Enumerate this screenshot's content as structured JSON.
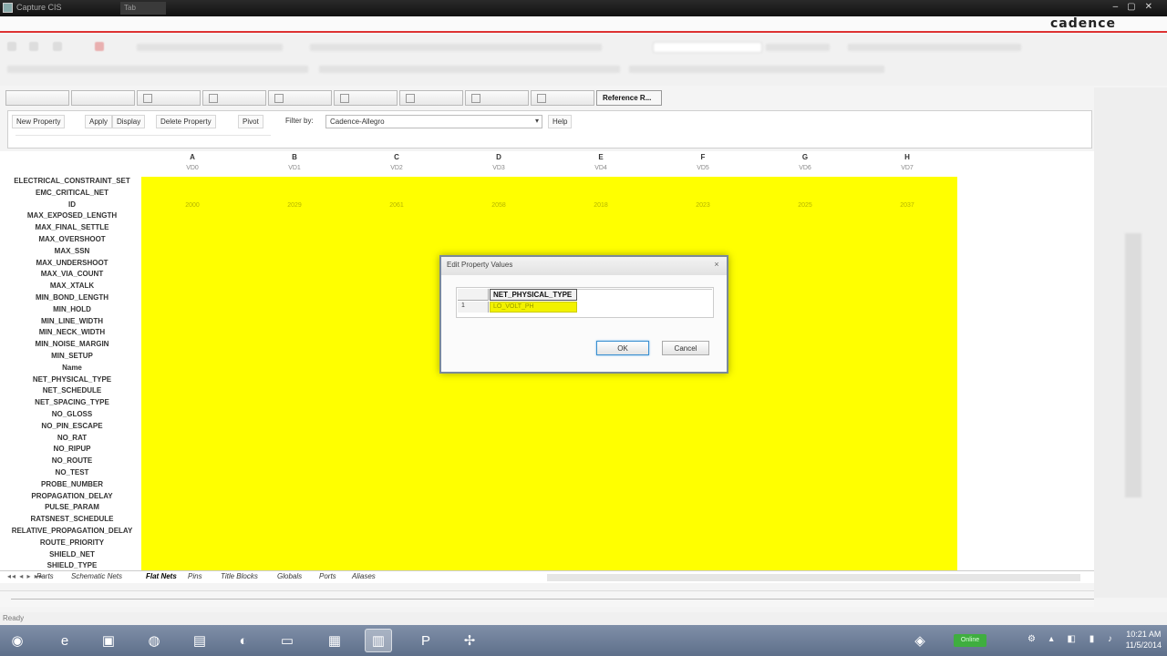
{
  "window": {
    "title": "Capture CIS",
    "second_tab": "Tab"
  },
  "brand": "cadence",
  "ribbon": {
    "active_tab": "Reference R..."
  },
  "property_toolbar": {
    "new_property": "New Property",
    "apply": "Apply",
    "display": "Display",
    "delete_property": "Delete Property",
    "pivot": "Pivot",
    "filter_label": "Filter by:",
    "filter_value": "Cadence-Allegro",
    "help": "Help"
  },
  "sheet": {
    "columns": [
      {
        "letter": "A",
        "net": "VD0",
        "id": "2000"
      },
      {
        "letter": "B",
        "net": "VD1",
        "id": "2029"
      },
      {
        "letter": "C",
        "net": "VD2",
        "id": "2061"
      },
      {
        "letter": "D",
        "net": "VD3",
        "id": "2058"
      },
      {
        "letter": "E",
        "net": "VD4",
        "id": "2018"
      },
      {
        "letter": "F",
        "net": "VD5",
        "id": "2023"
      },
      {
        "letter": "G",
        "net": "VD6",
        "id": "2025"
      },
      {
        "letter": "H",
        "net": "VD7",
        "id": "2037"
      }
    ],
    "row_labels": [
      "ELECTRICAL_CONSTRAINT_SET",
      "EMC_CRITICAL_NET",
      "ID",
      "MAX_EXPOSED_LENGTH",
      "MAX_FINAL_SETTLE",
      "MAX_OVERSHOOT",
      "MAX_SSN",
      "MAX_UNDERSHOOT",
      "MAX_VIA_COUNT",
      "MAX_XTALK",
      "MIN_BOND_LENGTH",
      "MIN_HOLD",
      "MIN_LINE_WIDTH",
      "MIN_NECK_WIDTH",
      "MIN_NOISE_MARGIN",
      "MIN_SETUP",
      "Name",
      "NET_PHYSICAL_TYPE",
      "NET_SCHEDULE",
      "NET_SPACING_TYPE",
      "NO_GLOSS",
      "NO_PIN_ESCAPE",
      "NO_RAT",
      "NO_RIPUP",
      "NO_ROUTE",
      "NO_TEST",
      "PROBE_NUMBER",
      "PROPAGATION_DELAY",
      "PULSE_PARAM",
      "RATSNEST_SCHEDULE",
      "RELATIVE_PROPAGATION_DELAY",
      "ROUTE_PRIORITY",
      "SHIELD_NET",
      "SHIELD_TYPE"
    ]
  },
  "sheet_tabs": [
    "Parts",
    "Schematic Nets",
    "Flat Nets",
    "Pins",
    "Title Blocks",
    "Globals",
    "Ports",
    "Aliases"
  ],
  "active_sheet_tab": "Flat Nets",
  "status_text": "Ready",
  "dialog": {
    "title": "Edit Property Values",
    "close": "×",
    "column_header": "NET_PHYSICAL_TYPE",
    "row_number": "1",
    "cell_value": "LO_VOLT_PH",
    "ok": "OK",
    "cancel": "Cancel"
  },
  "taskbar": {
    "time": "10:21 AM",
    "date": "11/5/2014",
    "icons": [
      "start-orb-icon",
      "ie-icon",
      "media-icon",
      "chrome-icon",
      "notepad-icon",
      "firefox-icon",
      "explorer-icon",
      "monitor-icon",
      "capture-icon",
      "powerpoint-icon",
      "network-icon"
    ],
    "indicator": "Online"
  },
  "colors": {
    "highlight": "#ffff00",
    "brand_rule": "#dd3333"
  }
}
